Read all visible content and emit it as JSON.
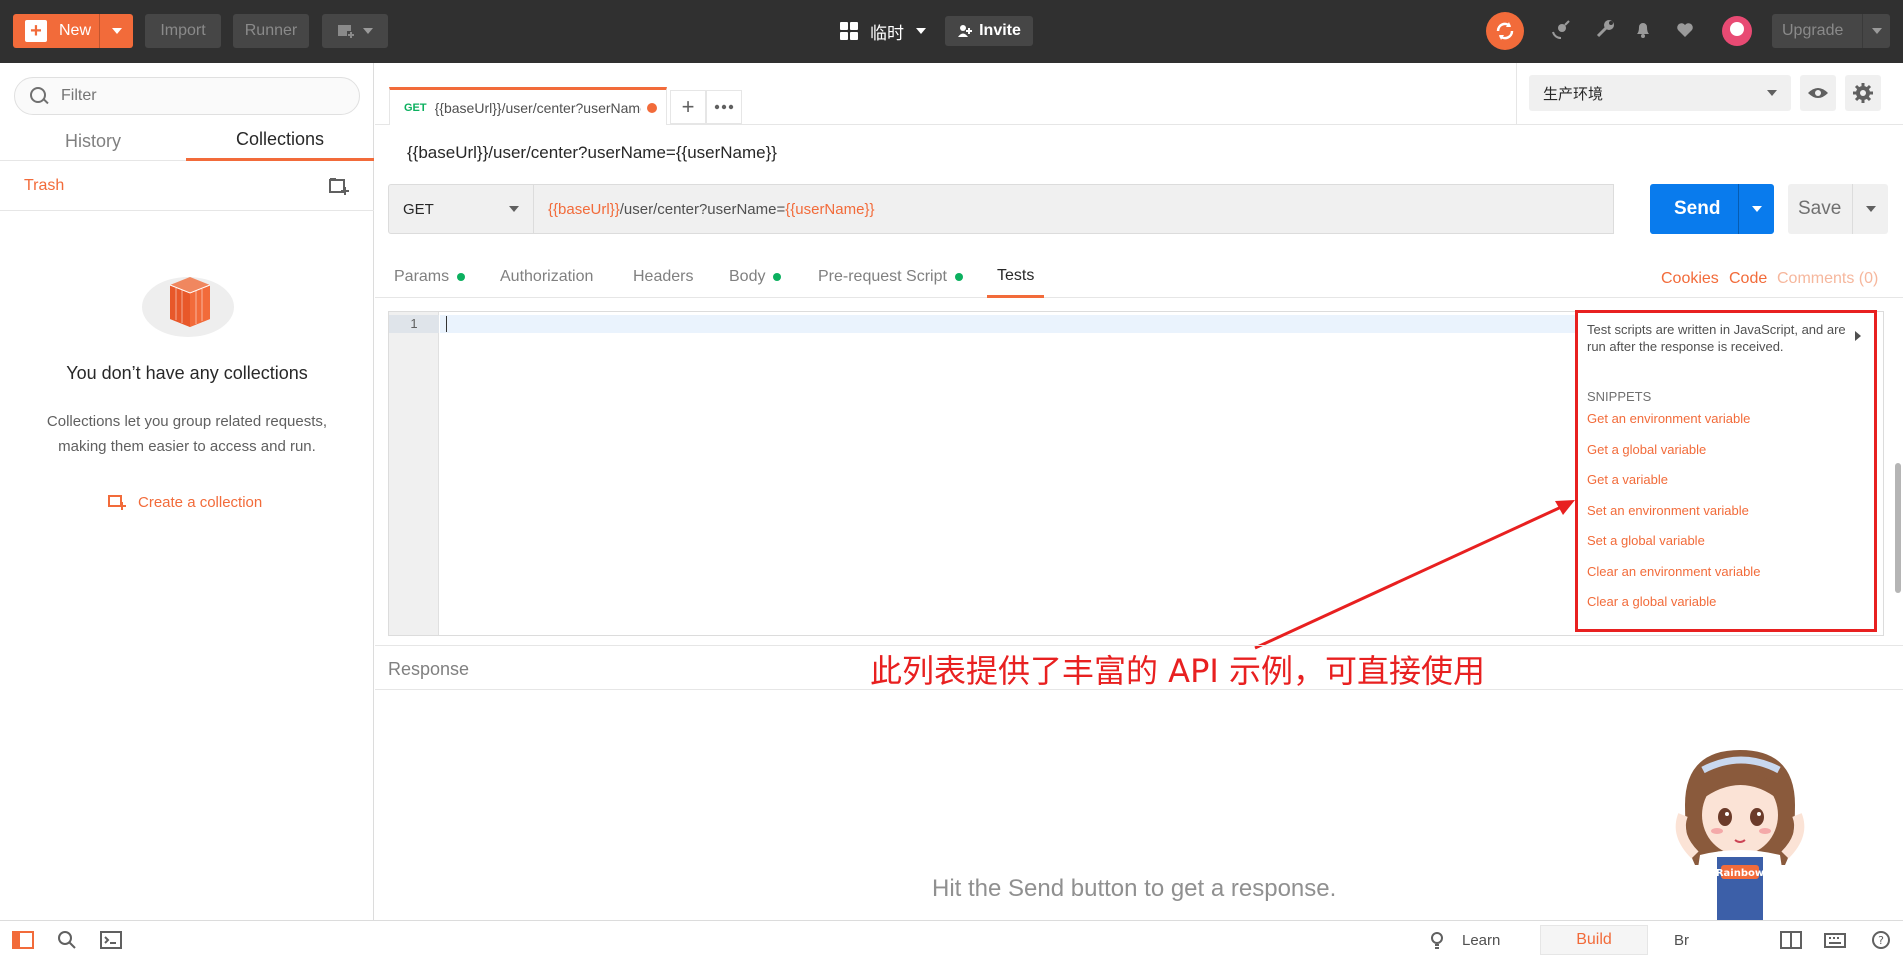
{
  "header": {
    "new_label": "New",
    "import_label": "Import",
    "runner_label": "Runner",
    "workspace_label": "临时",
    "invite_label": "Invite",
    "upgrade_label": "Upgrade",
    "accent": "#f26b3a"
  },
  "sidebar": {
    "filter_placeholder": "Filter",
    "tabs": [
      "History",
      "Collections"
    ],
    "active_tab": "Collections",
    "trash_label": "Trash",
    "empty_title": "You don’t have any collections",
    "empty_desc": "Collections let you group related requests, making them easier to access and run.",
    "create_label": "Create a collection"
  },
  "request_tab": {
    "method": "GET",
    "title": "{{baseUrl}}/user/center?userName={{userName}}"
  },
  "environment": {
    "selected": "生产环境"
  },
  "request": {
    "name": "{{baseUrl}}/user/center?userName={{userName}}",
    "method": "GET",
    "url_var1": "{{baseUrl}}",
    "url_plain": "/user/center?userName=",
    "url_var2": "{{userName}}",
    "send_label": "Send",
    "save_label": "Save"
  },
  "request_tabs": [
    {
      "label": "Params",
      "dot": true
    },
    {
      "label": "Authorization",
      "dot": false
    },
    {
      "label": "Headers",
      "dot": false
    },
    {
      "label": "Body",
      "dot": true
    },
    {
      "label": "Pre-request Script",
      "dot": true
    },
    {
      "label": "Tests",
      "dot": false,
      "active": true
    }
  ],
  "right_links": {
    "cookies": "Cookies",
    "code": "Code",
    "comments": "Comments (0)"
  },
  "editor": {
    "line_number": "1"
  },
  "snippets": {
    "description": "Test scripts are written in JavaScript, and are run after the response is received.",
    "header": "SNIPPETS",
    "items": [
      "Get an environment variable",
      "Get a global variable",
      "Get a variable",
      "Set an environment variable",
      "Set a global variable",
      "Clear an environment variable",
      "Clear a global variable"
    ]
  },
  "annotation": {
    "text": "此列表提供了丰富的 API 示例，可直接使用",
    "color": "#e82020"
  },
  "response": {
    "label": "Response",
    "hint": "Hit the Send button to get a response."
  },
  "footer": {
    "learn_label": "Learn",
    "build_label": "Build",
    "browse_label": "Br"
  }
}
